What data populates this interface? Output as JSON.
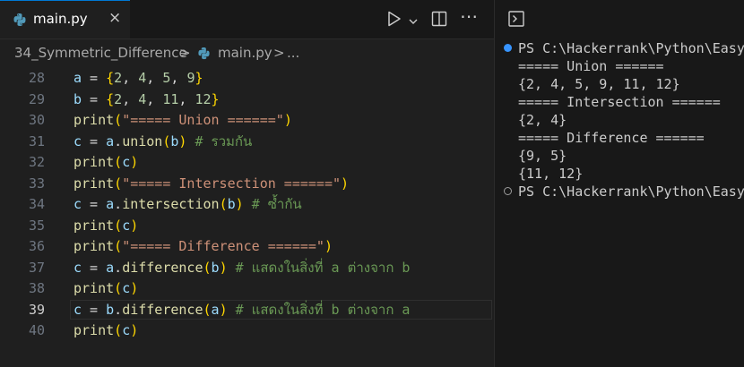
{
  "editor": {
    "tab": {
      "label": "main.py",
      "close": "×"
    },
    "breadcrumb": {
      "folder": "34_Symmetric_Difference",
      "separator": ">",
      "file": "main.py",
      "ellipsis": "..."
    },
    "lines": [
      {
        "num": "28",
        "tokens": [
          [
            "var",
            "a"
          ],
          [
            "op",
            " = "
          ],
          [
            "b1",
            "{"
          ],
          [
            "num",
            "2"
          ],
          [
            "op",
            ", "
          ],
          [
            "num",
            "4"
          ],
          [
            "op",
            ", "
          ],
          [
            "num",
            "5"
          ],
          [
            "op",
            ", "
          ],
          [
            "num",
            "9"
          ],
          [
            "b1",
            "}"
          ]
        ]
      },
      {
        "num": "29",
        "tokens": [
          [
            "var",
            "b"
          ],
          [
            "op",
            " = "
          ],
          [
            "b1",
            "{"
          ],
          [
            "num",
            "2"
          ],
          [
            "op",
            ", "
          ],
          [
            "num",
            "4"
          ],
          [
            "op",
            ", "
          ],
          [
            "num",
            "11"
          ],
          [
            "op",
            ", "
          ],
          [
            "num",
            "12"
          ],
          [
            "b1",
            "}"
          ]
        ]
      },
      {
        "num": "30",
        "tokens": [
          [
            "fn",
            "print"
          ],
          [
            "b1",
            "("
          ],
          [
            "str",
            "\"===== Union ======\""
          ],
          [
            "b1",
            ")"
          ]
        ]
      },
      {
        "num": "31",
        "tokens": [
          [
            "var",
            "c"
          ],
          [
            "op",
            " = "
          ],
          [
            "var",
            "a"
          ],
          [
            "op",
            "."
          ],
          [
            "fn",
            "union"
          ],
          [
            "b1",
            "("
          ],
          [
            "var",
            "b"
          ],
          [
            "b1",
            ")"
          ],
          [
            "op",
            " "
          ],
          [
            "cmt",
            "# รวมกัน"
          ]
        ]
      },
      {
        "num": "32",
        "tokens": [
          [
            "fn",
            "print"
          ],
          [
            "b1",
            "("
          ],
          [
            "var",
            "c"
          ],
          [
            "b1",
            ")"
          ]
        ]
      },
      {
        "num": "33",
        "tokens": [
          [
            "fn",
            "print"
          ],
          [
            "b1",
            "("
          ],
          [
            "str",
            "\"===== Intersection ======\""
          ],
          [
            "b1",
            ")"
          ]
        ]
      },
      {
        "num": "34",
        "tokens": [
          [
            "var",
            "c"
          ],
          [
            "op",
            " = "
          ],
          [
            "var",
            "a"
          ],
          [
            "op",
            "."
          ],
          [
            "fn",
            "intersection"
          ],
          [
            "b1",
            "("
          ],
          [
            "var",
            "b"
          ],
          [
            "b1",
            ")"
          ],
          [
            "op",
            " "
          ],
          [
            "cmt",
            "# ซ้ำกัน"
          ]
        ]
      },
      {
        "num": "35",
        "tokens": [
          [
            "fn",
            "print"
          ],
          [
            "b1",
            "("
          ],
          [
            "var",
            "c"
          ],
          [
            "b1",
            ")"
          ]
        ]
      },
      {
        "num": "36",
        "tokens": [
          [
            "fn",
            "print"
          ],
          [
            "b1",
            "("
          ],
          [
            "str",
            "\"===== Difference ======\""
          ],
          [
            "b1",
            ")"
          ]
        ]
      },
      {
        "num": "37",
        "tokens": [
          [
            "var",
            "c"
          ],
          [
            "op",
            " = "
          ],
          [
            "var",
            "a"
          ],
          [
            "op",
            "."
          ],
          [
            "fn",
            "difference"
          ],
          [
            "b1",
            "("
          ],
          [
            "var",
            "b"
          ],
          [
            "b1",
            ")"
          ],
          [
            "op",
            " "
          ],
          [
            "cmt",
            "# แสดงในสิ่งที่ a ต่างจาก b"
          ]
        ]
      },
      {
        "num": "38",
        "tokens": [
          [
            "fn",
            "print"
          ],
          [
            "b1",
            "("
          ],
          [
            "var",
            "c"
          ],
          [
            "b1",
            ")"
          ]
        ]
      },
      {
        "num": "39",
        "active": true,
        "tokens": [
          [
            "var",
            "c"
          ],
          [
            "op",
            " = "
          ],
          [
            "var",
            "b"
          ],
          [
            "op",
            "."
          ],
          [
            "fn",
            "difference"
          ],
          [
            "b1",
            "("
          ],
          [
            "var",
            "a"
          ],
          [
            "b1",
            ")"
          ],
          [
            "op",
            " "
          ],
          [
            "cmt",
            "# แสดงในสิ่งที่ b ต่างจาก a"
          ]
        ]
      },
      {
        "num": "40",
        "tokens": [
          [
            "fn",
            "print"
          ],
          [
            "b1",
            "("
          ],
          [
            "var",
            "c"
          ],
          [
            "b1",
            ")"
          ]
        ]
      }
    ]
  },
  "terminal": {
    "lines": [
      {
        "text": "PS C:\\Hackerrank\\Python\\Easy",
        "marker": "blue"
      },
      {
        "text": "===== Union ======"
      },
      {
        "text": "{2, 4, 5, 9, 11, 12}"
      },
      {
        "text": "===== Intersection ======"
      },
      {
        "text": "{2, 4}"
      },
      {
        "text": "===== Difference ======"
      },
      {
        "text": "{9, 5}"
      },
      {
        "text": "{11, 12}"
      },
      {
        "text": "PS C:\\Hackerrank\\Python\\Easy",
        "marker": "gray"
      }
    ]
  },
  "colors": {
    "accent": "#0078d4",
    "terminal_dot_blue": "#3794ff"
  }
}
